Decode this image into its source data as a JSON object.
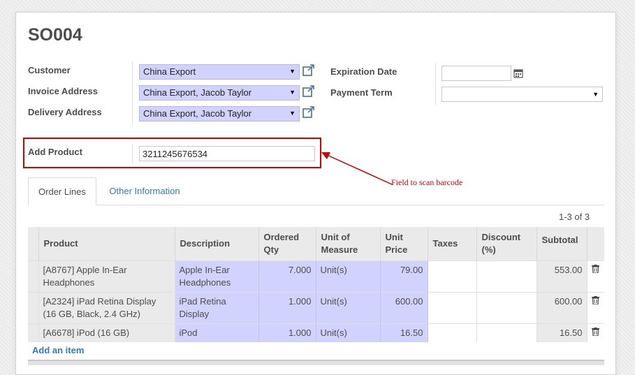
{
  "record": {
    "title": "SO004"
  },
  "fields": {
    "customer": {
      "label": "Customer",
      "value": "China Export"
    },
    "invoice_address": {
      "label": "Invoice Address",
      "value": "China Export, Jacob Taylor"
    },
    "delivery_address": {
      "label": "Delivery Address",
      "value": "China Export, Jacob Taylor"
    },
    "expiration_date": {
      "label": "Expiration Date",
      "value": ""
    },
    "payment_term": {
      "label": "Payment Term",
      "value": ""
    },
    "add_product": {
      "label": "Add Product",
      "value": "3211245676534"
    }
  },
  "annotation": {
    "text": "Field to scan barcode",
    "color": "#cc0000"
  },
  "tabs": [
    {
      "label": "Order Lines",
      "active": true
    },
    {
      "label": "Other Information",
      "active": false
    }
  ],
  "pager": {
    "text": "1-3 of 3"
  },
  "table": {
    "columns": {
      "product": "Product",
      "description": "Description",
      "ordered_qty_1": "Ordered",
      "ordered_qty_2": "Qty",
      "uom_1": "Unit of",
      "uom_2": "Measure",
      "unit_price_1": "Unit",
      "unit_price_2": "Price",
      "taxes": "Taxes",
      "discount_1": "Discount",
      "discount_2": "(%)",
      "subtotal": "Subtotal"
    },
    "rows": [
      {
        "product": "[A8767] Apple In-Ear Headphones",
        "description": "Apple In-Ear Headphones",
        "qty": "7.000",
        "uom": "Unit(s)",
        "price": "79.00",
        "taxes": "",
        "discount": "",
        "subtotal": "553.00"
      },
      {
        "product": "[A2324] iPad Retina Display (16 GB, Black, 2.4 GHz)",
        "description": "iPad Retina Display",
        "qty": "1.000",
        "uom": "Unit(s)",
        "price": "600.00",
        "taxes": "",
        "discount": "",
        "subtotal": "600.00"
      },
      {
        "product": "[A6678] iPod (16 GB)",
        "description": "iPod",
        "qty": "1.000",
        "uom": "Unit(s)",
        "price": "16.50",
        "taxes": "",
        "discount": "",
        "subtotal": "16.50"
      }
    ],
    "add_item_label": "Add an item"
  },
  "colors": {
    "required_field": "#d2d2ff",
    "link": "#337ab7",
    "highlight_border": "#d40000"
  },
  "icons": {
    "external_link": "external-link-icon",
    "calendar": "calendar-icon",
    "trash": "trash-icon",
    "dropdown": "caret-down-icon"
  }
}
